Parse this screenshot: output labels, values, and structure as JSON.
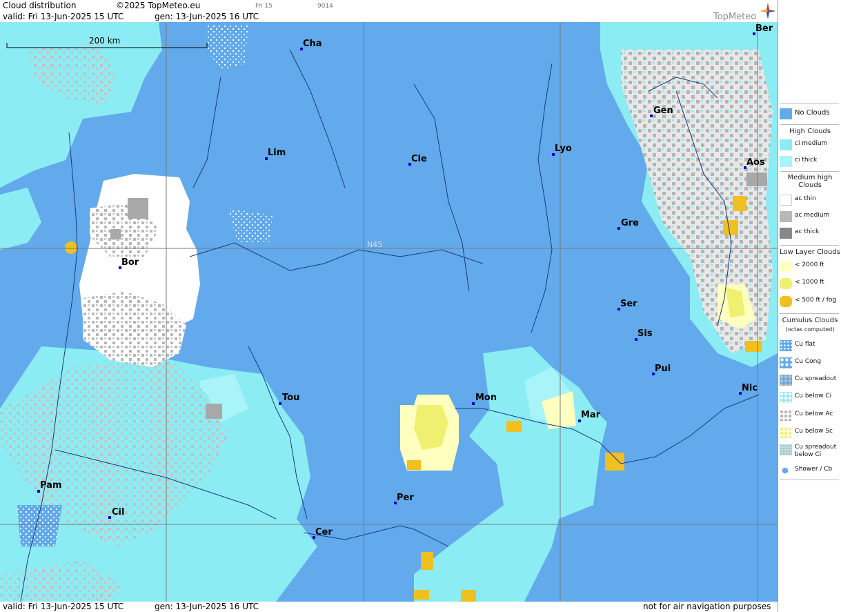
{
  "header": {
    "title": "Cloud distribution",
    "copyright": "©2025 TopMeteo.eu",
    "valid": "valid:  Fri  13-Jun-2025  15 UTC",
    "gen": "gen: 13-Jun-2025 16 UTC",
    "day_tab": "Fri 15",
    "code": "9014",
    "brand": "TopMeteo"
  },
  "map": {
    "scale_label": "200 km",
    "grid_label": "N45",
    "cities": [
      {
        "name": "Cha"
      },
      {
        "name": "Ber"
      },
      {
        "name": "Gen"
      },
      {
        "name": "Lim"
      },
      {
        "name": "Cle"
      },
      {
        "name": "Lyo"
      },
      {
        "name": "Aos"
      },
      {
        "name": "Gre"
      },
      {
        "name": "Bor"
      },
      {
        "name": "Ser"
      },
      {
        "name": "Sis"
      },
      {
        "name": "Pui"
      },
      {
        "name": "Tou"
      },
      {
        "name": "Mon"
      },
      {
        "name": "Mar"
      },
      {
        "name": "Nic"
      },
      {
        "name": "Pam"
      },
      {
        "name": "Per"
      },
      {
        "name": "Cil"
      },
      {
        "name": "Cer"
      }
    ],
    "colors": {
      "no_clouds": "#62aaeb",
      "ci_medium": "#8cecf4",
      "ci_thick": "#a8f4f8",
      "ac_thin": "#ffffff",
      "ac_medium": "#b8b8b8",
      "ac_thick": "#888888",
      "low_2000": "#ffffc0",
      "low_1000": "#f0f070",
      "low_500": "#f0c020"
    }
  },
  "footer": {
    "valid": "valid:  Fri  13-Jun-2025  15 UTC",
    "gen": "gen: 13-Jun-2025 16 UTC",
    "disclaimer": "not for air navigation purposes"
  },
  "legend": {
    "no_clouds": "No Clouds",
    "high_title": "High Clouds",
    "ci_medium": "ci medium",
    "ci_thick": "ci thick",
    "medium_title": "Medium high Clouds",
    "ac_thin": "ac thin",
    "ac_medium": "ac medium",
    "ac_thick": "ac thick",
    "low_title": "Low Layer Clouds",
    "low_2000": "< 2000 ft",
    "low_1000": "< 1000 ft",
    "low_500": "< 500 ft / fog",
    "cu_title": "Cumulus Clouds",
    "cu_sub": "(octas computed)",
    "cu_flat": "Cu flat",
    "cu_cong": "Cu Cong",
    "cu_spreadout": "Cu spreadout",
    "cu_below_ci": "Cu below Ci",
    "cu_below_ac": "Cu below Ac",
    "cu_below_sc": "Cu below Sc",
    "cu_spread_ci": "Cu spreadout below Ci",
    "shower": "Shower / Cb"
  }
}
